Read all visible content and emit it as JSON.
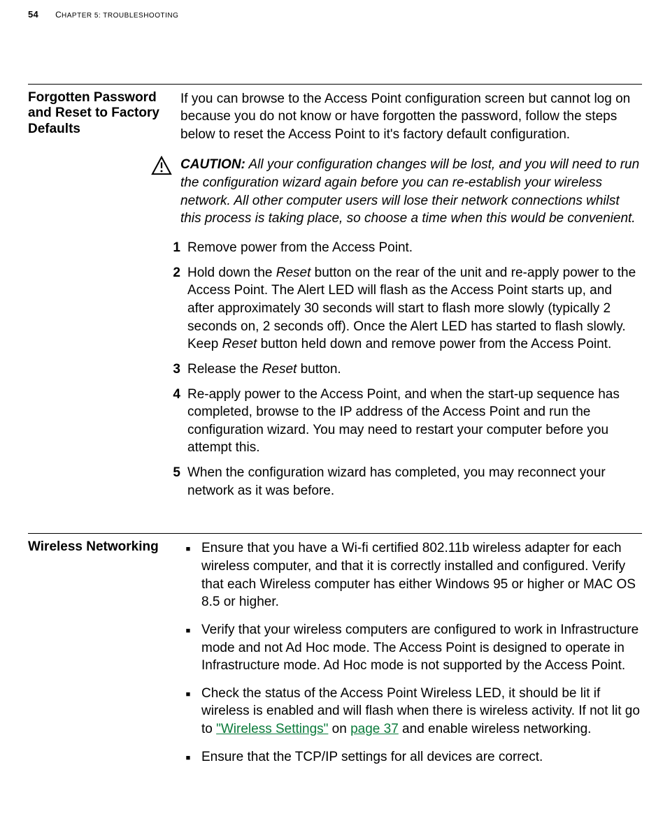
{
  "header": {
    "page_number": "54",
    "chapter_prefix": "C",
    "chapter_rest": "HAPTER 5: T",
    "chapter_tail": "ROUBLESHOOTING"
  },
  "section1": {
    "heading": "Forgotten Password and Reset to Factory Defaults",
    "intro": "If you can browse to the Access Point configuration screen but cannot log on because you do not know or have forgotten the password, follow the steps below to reset the Access Point to it's factory default configuration.",
    "caution_label": "CAUTION:",
    "caution_text": " All your configuration changes will be lost, and you will need to run the configuration wizard again before you can re-establish your wireless network. All other computer users will lose their network connections whilst this process is taking place, so choose a time when this would be convenient.",
    "step1": "Remove power from the Access Point.",
    "step2_a": "Hold down the ",
    "step2_reset": "Reset",
    "step2_b": " button on the rear of the unit and re-apply power to the Access Point. The Alert LED will flash as the Access Point starts up, and after approximately 30 seconds will start to flash more slowly (typically 2 seconds on, 2 seconds off). Once the Alert LED has started to flash slowly. Keep ",
    "step2_c": " button held down and remove power from the Access Point.",
    "step3_a": "Release the ",
    "step3_b": " button.",
    "step4": "Re-apply power to the Access Point, and when the start-up sequence has completed, browse to the IP address of the Access Point and run the configuration wizard. You may need to restart your computer before you attempt this.",
    "step5": "When the configuration wizard has completed, you may reconnect your network as it was before.",
    "n1": "1",
    "n2": "2",
    "n3": "3",
    "n4": "4",
    "n5": "5"
  },
  "section2": {
    "heading": "Wireless Networking",
    "b1": "Ensure that you have a Wi-fi certified 802.11b wireless adapter for each wireless computer, and that it is correctly installed and configured. Verify that each Wireless computer has either Windows 95 or higher or MAC OS 8.5 or higher.",
    "b2": "Verify that your wireless computers are configured to work in Infrastructure mode and not Ad Hoc mode. The Access Point is designed to operate in Infrastructure mode. Ad Hoc mode is not supported by the Access Point.",
    "b3_a": "Check the status of the Access Point Wireless LED, it should be lit if wireless is enabled and will flash when there is wireless activity. If not lit go to ",
    "b3_link1": "\"Wireless Settings\"",
    "b3_b": " on ",
    "b3_link2": "page 37",
    "b3_c": " and enable wireless networking.",
    "b4": "Ensure that the TCP/IP settings for all devices are correct."
  }
}
